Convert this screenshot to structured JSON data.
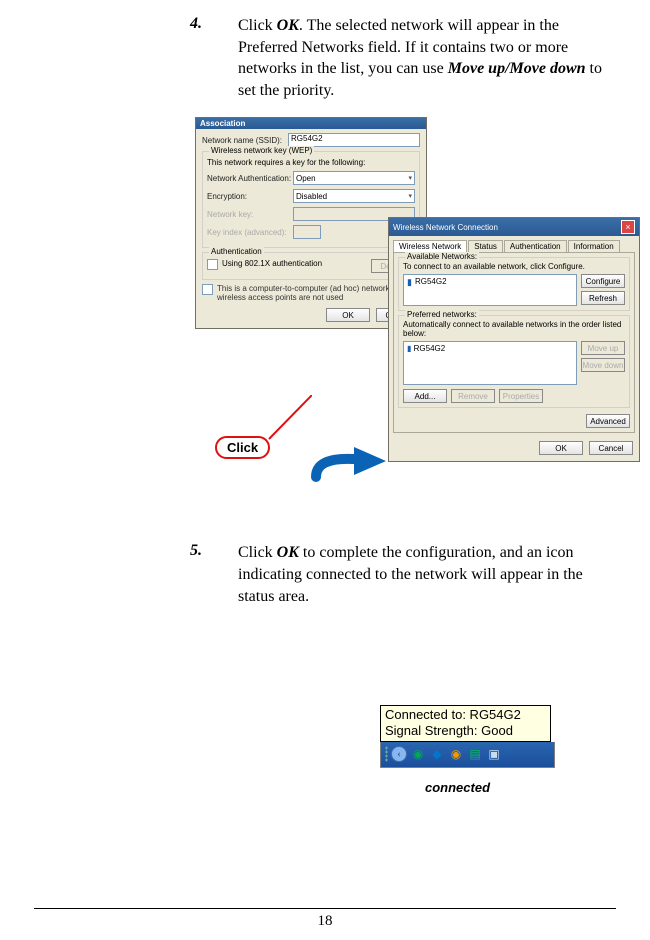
{
  "step4": {
    "number": "4.",
    "pre": "Click ",
    "ok": "OK",
    "mid": ".  The selected network will appear in the Preferred Networks field.  If it contains two or more networks in the list, you can use ",
    "move": "Move up/Move down",
    "suffix": " to set the priority."
  },
  "step5": {
    "number": "5.",
    "pre": "Click ",
    "ok": "OK",
    "suffix": " to complete the configuration, and an icon indicating connected to the network will appear in the status area."
  },
  "dialog1": {
    "title": "Association",
    "ssid_label": "Network name (SSID):",
    "ssid_value": "RG54G2",
    "wep_legend": "Wireless network key (WEP)",
    "wep_note": "This network requires a key for the following:",
    "auth_label": "Network Authentication:",
    "auth_value": "Open",
    "enc_label": "Encryption:",
    "enc_value": "Disabled",
    "key_label": "Network key:",
    "keyidx_label": "Key index (advanced):",
    "authn_legend": "Authentication",
    "use8021x": "Using 802.1X authentication",
    "default_btn": "Default",
    "adhoc": "This is a computer-to-computer (ad hoc) network; wireless access points are not used",
    "ok": "OK",
    "cancel": "Cancel"
  },
  "dialog2": {
    "title": "Wireless Network Connection",
    "tabs": {
      "t1": "Wireless Network",
      "t2": "Status",
      "t3": "Authentication",
      "t4": "Information"
    },
    "avail_legend": "Available Networks:",
    "avail_note": "To connect to an available network, click Configure.",
    "avail_item": "RG54G2",
    "configure": "Configure",
    "refresh": "Refresh",
    "pref_legend": "Preferred networks:",
    "pref_note": "Automatically connect to available networks in the order listed below:",
    "pref_item": "RG54G2",
    "moveup": "Move up",
    "movedown": "Move down",
    "add": "Add...",
    "remove": "Remove",
    "properties": "Properties",
    "advanced": "Advanced",
    "ok": "OK",
    "cancel": "Cancel"
  },
  "callout": {
    "click": "Click"
  },
  "tooltip": {
    "line1": "Connected to: RG54G2",
    "line2": "Signal Strength: Good"
  },
  "connected_label": "connected",
  "page_number": "18"
}
